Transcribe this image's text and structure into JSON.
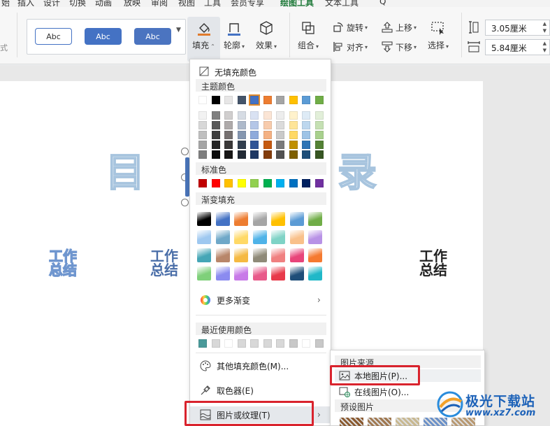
{
  "menubar": {
    "tabs": [
      "始",
      "插入",
      "设计",
      "切换",
      "动画",
      "放映",
      "审阅",
      "视图",
      "工具",
      "会员专享",
      "绘图工具",
      "文本工具",
      "Q"
    ],
    "active_tab": "绘图工具"
  },
  "ribbon": {
    "left_fragment": "式",
    "style_gallery": {
      "samples": [
        "Abc",
        "Abc",
        "Abc"
      ],
      "more_icon": "caret-down-icon"
    },
    "fill_label": "填充",
    "outline_label": "轮廓",
    "effect_label": "效果",
    "group_label": "组合",
    "rotate_label": "旋转",
    "align_label": "对齐",
    "move_up_label": "上移",
    "move_down_label": "下移",
    "select_label": "选择",
    "height_value": "3.05厘米",
    "width_value": "5.84厘米",
    "accent_color": "#e07b2c"
  },
  "slide": {
    "title_char_left": "目",
    "title_char_right": "录",
    "wordart_items": [
      {
        "text": "工作总结",
        "style": "outline"
      },
      {
        "text": "工作总结",
        "style": "blue"
      },
      {
        "text": "工作总结",
        "style": "black"
      }
    ]
  },
  "fill_menu": {
    "no_fill": "无填充颜色",
    "theme_colors_header": "主题颜色",
    "theme_top_row": [
      "#ffffff",
      "#000000",
      "#e7e6e6",
      "#44546a",
      "#4472c4",
      "#ed7d31",
      "#a5a5a5",
      "#ffc000",
      "#5b9bd5",
      "#70ad47"
    ],
    "theme_shades": [
      [
        "#f2f2f2",
        "#7f7f7f",
        "#d0cece",
        "#d6dce4",
        "#d9e2f3",
        "#fbe5d5",
        "#ededed",
        "#fff2cc",
        "#deebf6",
        "#e2efd9"
      ],
      [
        "#d8d8d8",
        "#595959",
        "#aeaaaa",
        "#adb9ca",
        "#b4c6e7",
        "#f7cbac",
        "#dbdbdb",
        "#fee599",
        "#bdd7ee",
        "#c5e0b3"
      ],
      [
        "#bfbfbf",
        "#3f3f3f",
        "#757070",
        "#8496b0",
        "#8eaadb",
        "#f4b183",
        "#c9c9c9",
        "#ffd965",
        "#9dc3e6",
        "#a8d08d"
      ],
      [
        "#a5a5a5",
        "#262626",
        "#3a3838",
        "#323f4f",
        "#2f5496",
        "#c55a11",
        "#7b7b7b",
        "#bf9000",
        "#2e75b5",
        "#538135"
      ],
      [
        "#7f7f7f",
        "#0c0c0c",
        "#171616",
        "#222a35",
        "#1f3864",
        "#833c0b",
        "#525252",
        "#7f6000",
        "#1e4e79",
        "#375623"
      ]
    ],
    "standard_header": "标准色",
    "standard_colors": [
      "#c00000",
      "#ff0000",
      "#ffc000",
      "#ffff00",
      "#92d050",
      "#00b050",
      "#00b0f0",
      "#0070c0",
      "#002060",
      "#7030a0"
    ],
    "gradient_header": "渐变填充",
    "gradients": [
      [
        "#000000",
        "#4472c4",
        "#ed7d31",
        "#a5a5a5",
        "#ffc000",
        "#5b9bd5",
        "#70ad47"
      ],
      [
        "#9ec8f0",
        "#6fa8c8",
        "#ffd966",
        "#4fb3e8",
        "#7fd3c6",
        "#f9c08a",
        "#b892e6"
      ],
      [
        "#45a6b6",
        "#b8866a",
        "#f5b942",
        "#8f8a78",
        "#f08080",
        "#e8457a",
        "#f57a30"
      ],
      [
        "#7fd07a",
        "#8b8bf0",
        "#c87ae8",
        "#e85a8a",
        "#e83a4a",
        "#1f4e79",
        "#20b8c8"
      ]
    ],
    "more_gradients": "更多渐变",
    "recent_header": "最近使用颜色",
    "recent_colors": [
      "#4a9a9a",
      "#d8d8d8",
      "#ffffff",
      "#d8d8d8",
      "#d8d8d8",
      "#d8d8d8",
      "#d8d8d8",
      "#c8c8c8",
      "#ffffff",
      "#c8c8c8"
    ],
    "other_colors": "其他填充颜色(M)...",
    "eyedropper": "取色器(E)",
    "picture_texture": "图片或纹理(T)"
  },
  "sub_menu": {
    "source_header": "图片来源",
    "local_picture": "本地图片(P)...",
    "online_picture": "在线图片(O)...",
    "preset_header": "预设图片",
    "textures": [
      "#8a5a30",
      "#a07850",
      "#c8b890",
      "#6a90c8",
      "#b89870"
    ]
  },
  "watermark": {
    "title": "极光下载站",
    "url": "www.xz7.com"
  }
}
